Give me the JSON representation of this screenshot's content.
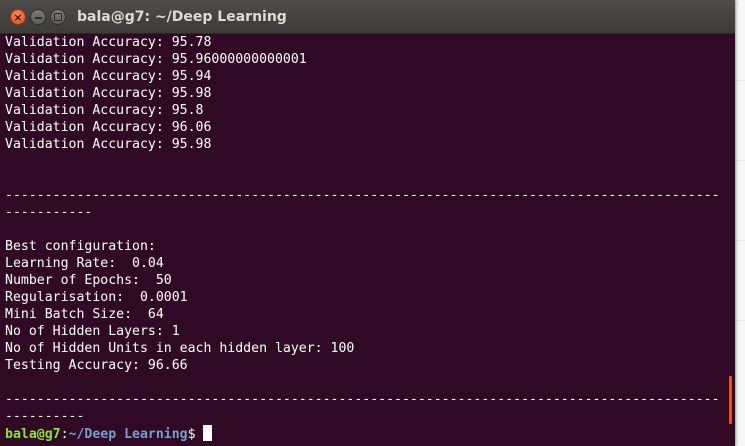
{
  "window": {
    "title": "bala@g7: ~/Deep Learning"
  },
  "terminal": {
    "lines": [
      "Validation Accuracy: 95.78",
      "Validation Accuracy: 95.96000000000001",
      "Validation Accuracy: 95.94",
      "Validation Accuracy: 95.98",
      "Validation Accuracy: 95.8",
      "Validation Accuracy: 96.06",
      "Validation Accuracy: 95.98",
      "",
      "",
      "------------------------------------------------------------------------------------------",
      "-----------",
      "",
      "Best configuration:",
      "Learning Rate:  0.04",
      "Number of Epochs:  50",
      "Regularisation:  0.0001",
      "Mini Batch Size:  64",
      "No of Hidden Layers: 1",
      "No of Hidden Units in each hidden layer: 100",
      "Testing Accuracy: 96.66",
      "",
      "------------------------------------------------------------------------------------------",
      "----------"
    ],
    "prompt": {
      "user_host": "bala@g7",
      "colon": ":",
      "path": "~/Deep Learning",
      "dollar": "$"
    }
  },
  "scroll_position": 0.95,
  "colors": {
    "terminal_background": "#300a24",
    "prompt_user": "#8ae234",
    "prompt_path": "#729fcf",
    "accent": "#e95420"
  }
}
